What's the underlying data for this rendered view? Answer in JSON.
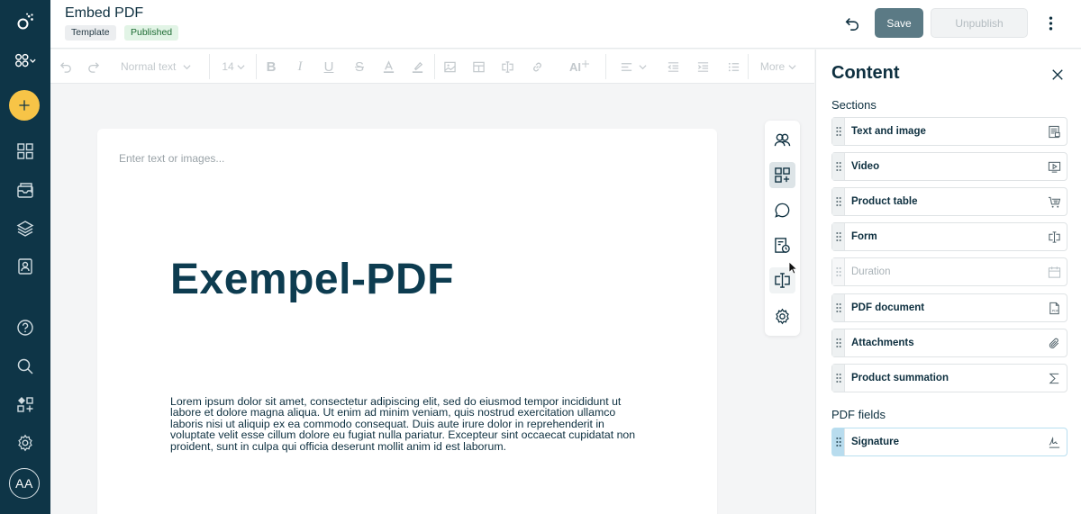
{
  "header": {
    "title": "Embed PDF",
    "badges": {
      "template": "Template",
      "published": "Published"
    },
    "save_label": "Save",
    "unpublish_label": "Unpublish"
  },
  "sidebar": {
    "avatar_initials": "AA",
    "icons": [
      "logo-icon",
      "network-icon",
      "add-icon",
      "grid-icon",
      "inbox-icon",
      "layers-icon",
      "contact-icon",
      "help-icon",
      "search-icon",
      "widgets-icon",
      "settings-icon"
    ]
  },
  "toolbar": {
    "text_style": "Normal text",
    "font_size": "14",
    "ai_label": "AI",
    "more_label": "More"
  },
  "editor": {
    "placeholder": "Enter text or images...",
    "heading": "Exempel-PDF",
    "body": "Lorem ipsum dolor sit amet, consectetur adipiscing elit, sed do eiusmod tempor incididunt ut labore et dolore magna aliqua. Ut enim ad minim veniam, quis nostrud exercitation ullamco laboris nisi ut aliquip ex ea commodo consequat. Duis aute irure dolor in reprehenderit in voluptate velit esse cillum dolore eu fugiat nulla pariatur. Excepteur sint occaecat cupidatat non proident, sunt in culpa qui officia deserunt mollit anim id est laborum."
  },
  "panel": {
    "title": "Content",
    "sections_label": "Sections",
    "sections": [
      {
        "label": "Text and image",
        "icon": "text-image-icon"
      },
      {
        "label": "Video",
        "icon": "video-icon"
      },
      {
        "label": "Product table",
        "icon": "cart-icon"
      },
      {
        "label": "Form",
        "icon": "form-icon"
      },
      {
        "label": "Duration",
        "icon": "calendar-icon"
      },
      {
        "label": "PDF document",
        "icon": "pdf-icon"
      },
      {
        "label": "Attachments",
        "icon": "paperclip-icon"
      },
      {
        "label": "Product summation",
        "icon": "sum-icon"
      }
    ],
    "pdf_fields_label": "PDF fields",
    "pdf_fields": [
      {
        "label": "Signature",
        "icon": "signature-icon"
      }
    ]
  },
  "colors": {
    "sidebar_bg": "#0e3547",
    "accent_add": "#f7c447",
    "save_button": "#5b7a85",
    "heading": "#0d3c50"
  }
}
